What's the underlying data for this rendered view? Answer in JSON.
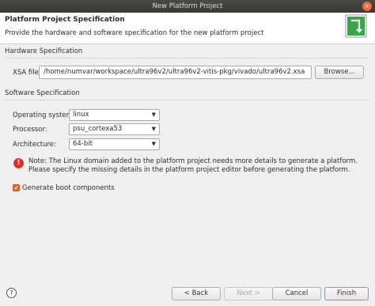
{
  "window": {
    "title": "New Platform Project",
    "close_glyph": "×"
  },
  "header": {
    "title": "Platform Project Specification",
    "subtitle": "Provide the hardware and software specification for the new platform project",
    "logo_icon": "platform-project-icon"
  },
  "hardware": {
    "group_label": "Hardware Specification",
    "xsa_label": "XSA file:",
    "xsa_value": "/home/numvar/workspace/ultra96v2/ultra96v2-vitis-pkg/vivado/ultra96v2.xsa",
    "browse_label": "Browse..."
  },
  "software": {
    "group_label": "Software Specification",
    "os_label": "Operating system:",
    "os_value": "linux",
    "processor_label": "Processor:",
    "processor_value": "psu_cortexa53",
    "architecture_label": "Architecture:",
    "architecture_value": "64-bit"
  },
  "note": {
    "icon": "error-icon",
    "text": "Note: The Linux domain added to the platform project needs more details to generate a platform. Please specify the missing details in the platform project editor before generating the platform."
  },
  "boot": {
    "label": "Generate boot components",
    "checked": true
  },
  "footer": {
    "help_glyph": "?",
    "back_label": "< Back",
    "next_label": "Next >",
    "cancel_label": "Cancel",
    "finish_label": "Finish"
  },
  "colors": {
    "accent": "#e36a2e",
    "error": "#d8322f",
    "logo_green": "#3aa54a"
  }
}
